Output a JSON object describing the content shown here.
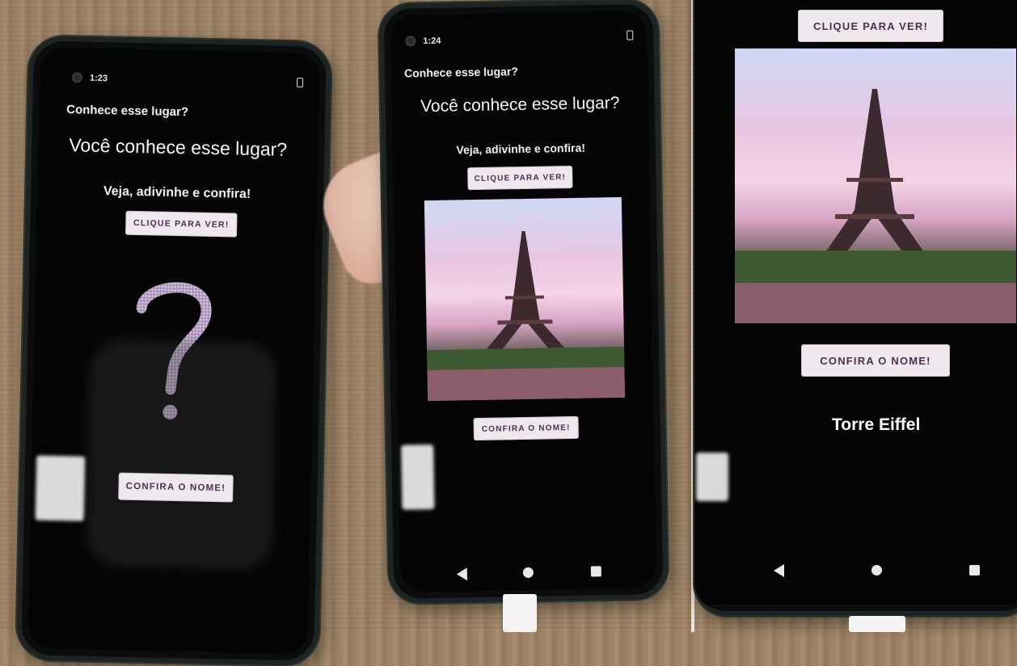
{
  "frames": [
    {
      "status_time": "1:23",
      "app_title": "Conhece esse lugar?",
      "heading": "Você conhece esse lugar?",
      "subtitle": "Veja, adivinhe e confira!",
      "show_button": "CLIQUE PARA VER!",
      "image_state": "question-mark",
      "confirm_button": "CONFIRA O NOME!"
    },
    {
      "status_time": "1:24",
      "app_title": "Conhece esse lugar?",
      "heading": "Você conhece esse lugar?",
      "subtitle": "Veja, adivinhe e confira!",
      "show_button": "CLIQUE PARA VER!",
      "image_state": "eiffel-tower-photo",
      "confirm_button": "CONFIRA O NOME!",
      "nav_icons": [
        "back-icon",
        "home-icon",
        "recents-icon"
      ]
    },
    {
      "show_button": "CLIQUE PARA VER!",
      "image_state": "eiffel-tower-photo",
      "confirm_button": "CONFIRA O NOME!",
      "answer": "Torre Eiffel",
      "nav_icons": [
        "back-icon",
        "home-icon",
        "recents-icon"
      ]
    }
  ],
  "colors": {
    "screen_bg": "#050505",
    "button_bg": "#efe8ee",
    "button_text": "#4e2f52",
    "question_mark": "#c7b2cf",
    "text": "#f5f5f5"
  }
}
